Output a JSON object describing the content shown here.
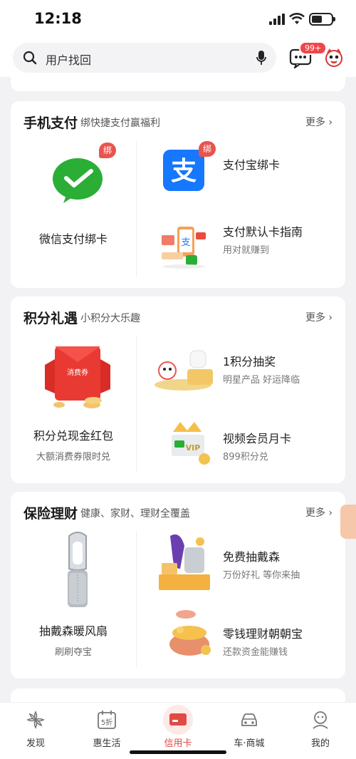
{
  "status": {
    "time": "12:18"
  },
  "search": {
    "placeholder": "用户找回"
  },
  "header": {
    "badge": "99+"
  },
  "sections": {
    "pay": {
      "title": "手机支付",
      "subtitle": "绑快捷支付赢福利",
      "more": "更多",
      "left": {
        "title": "微信支付绑卡",
        "badge": "绑"
      },
      "right": [
        {
          "title": "支付宝绑卡",
          "badge": "绑"
        },
        {
          "title": "支付默认卡指南",
          "subtitle": "用对就赚到"
        }
      ]
    },
    "points": {
      "title": "积分礼遇",
      "subtitle": "小积分大乐趣",
      "more": "更多",
      "left": {
        "title": "积分兑现金红包",
        "subtitle": "大额消费券限时兑",
        "envelope_text": "消费券"
      },
      "right": [
        {
          "title": "1积分抽奖",
          "subtitle": "明星产品 好运降临"
        },
        {
          "title": "视频会员月卡",
          "subtitle": "899积分兑",
          "vip": "VIP"
        }
      ]
    },
    "insurance": {
      "title": "保险理财",
      "subtitle": "健康、家财、理财全覆盖",
      "more": "更多",
      "left": {
        "title": "抽戴森暖风扇",
        "subtitle": "刷刷夺宝"
      },
      "right": [
        {
          "title": "免费抽戴森",
          "subtitle": "万份好礼 等你来抽"
        },
        {
          "title": "零钱理财朝朝宝",
          "subtitle": "还款资金能赚钱"
        }
      ]
    }
  },
  "tabs": [
    {
      "label": "发现",
      "icon": "discover-icon"
    },
    {
      "label": "惠生活",
      "icon": "discount-icon",
      "glyph": "5折"
    },
    {
      "label": "信用卡",
      "icon": "credit-card-icon",
      "active": true
    },
    {
      "label": "车·商城",
      "icon": "car-icon"
    },
    {
      "label": "我的",
      "icon": "profile-icon"
    }
  ],
  "colors": {
    "accent": "#e24a44",
    "wechat": "#2aae36",
    "alipay": "#1677ff"
  }
}
